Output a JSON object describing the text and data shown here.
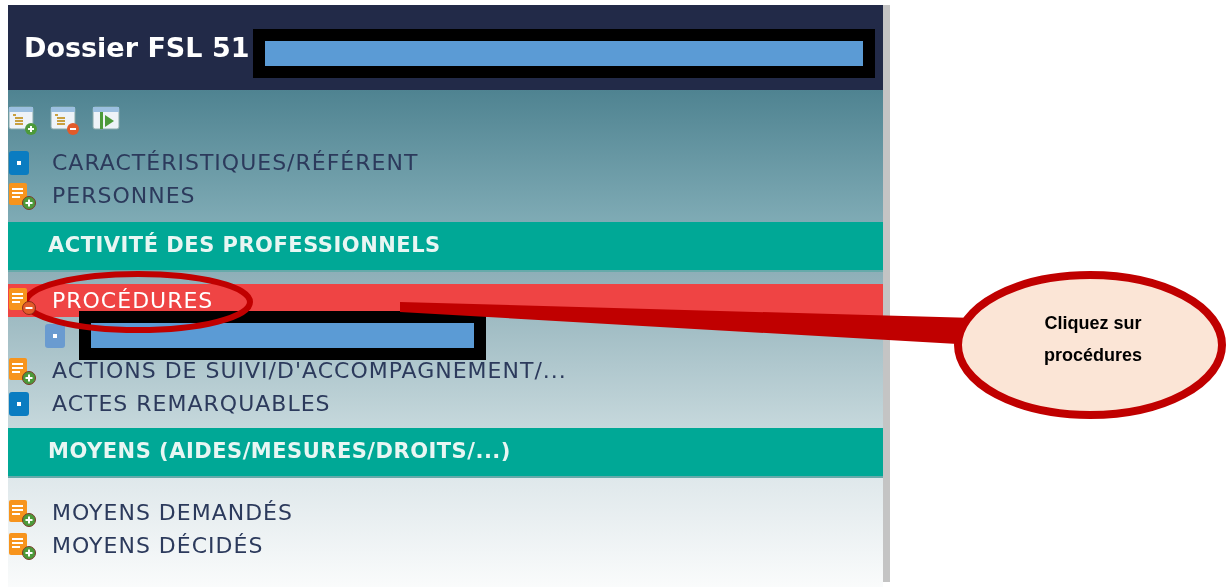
{
  "window": {
    "title": "Dossier FSL 51"
  },
  "sections": [
    {
      "kind": "plain",
      "items": [
        {
          "kind": "square",
          "label": "CARACTÉRISTIQUES/RÉFÉRENT",
          "selected": false
        },
        {
          "kind": "doc-plus",
          "label": "PERSONNES",
          "selected": false
        }
      ]
    },
    {
      "kind": "header",
      "title": "ACTIVITÉ DES PROFESSIONNELS",
      "items": [
        {
          "kind": "doc-minus",
          "label": "PROCÉDURES",
          "selected": true,
          "children": [
            {
              "kind": "redacted"
            }
          ]
        },
        {
          "kind": "doc-plus",
          "label": "ACTIONS DE SUIVI/D'ACCOMPAGNEMENT/...",
          "selected": false
        },
        {
          "kind": "square",
          "label": "ACTES REMARQUABLES",
          "selected": false
        }
      ]
    },
    {
      "kind": "header",
      "title": "MOYENS (AIDES/MESURES/DROITS/...)",
      "items": [
        {
          "kind": "doc-plus",
          "label": "MOYENS DEMANDÉS",
          "selected": false
        },
        {
          "kind": "doc-plus",
          "label": "MOYENS DÉCIDÉS",
          "selected": false
        }
      ]
    }
  ],
  "callout": {
    "text": "Cliquez sur procédures"
  }
}
